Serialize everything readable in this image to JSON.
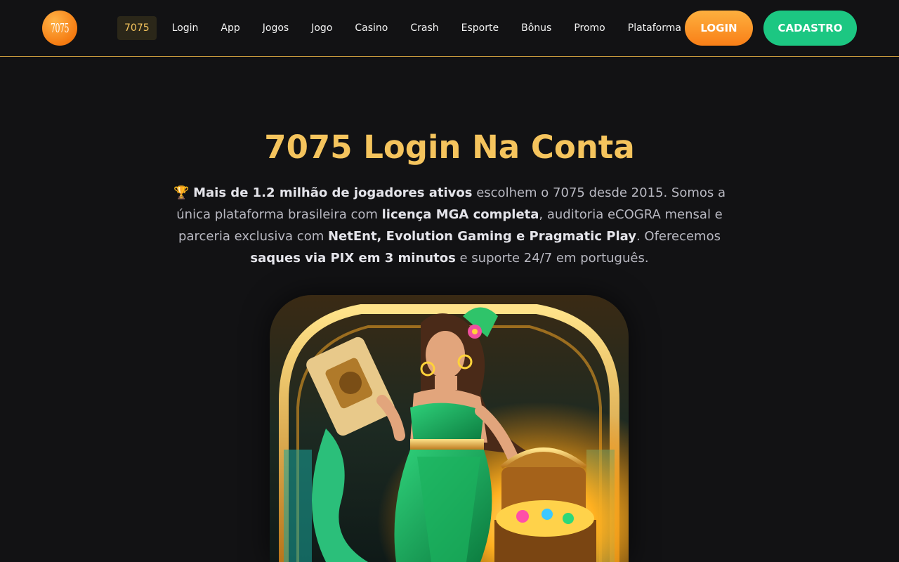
{
  "header": {
    "logo_text": "7075",
    "nav": [
      {
        "label": "7075",
        "active": true
      },
      {
        "label": "Login"
      },
      {
        "label": "App"
      },
      {
        "label": "Jogos"
      },
      {
        "label": "Jogo"
      },
      {
        "label": "Casino"
      },
      {
        "label": "Crash"
      },
      {
        "label": "Esporte"
      },
      {
        "label": "Bônus"
      },
      {
        "label": "Promo"
      },
      {
        "label": "Plataforma"
      }
    ],
    "login_button": "LOGIN",
    "signup_button": "CADASTRO"
  },
  "main": {
    "title": "7075 Login Na Conta",
    "intro": {
      "trophy_icon": "🏆",
      "p1_bold": "Mais de 1.2 milhão de jogadores ativos",
      "p2": " escolhem o 7075 desde 2015. Somos a única plataforma brasileira com ",
      "p3_bold": "licença MGA completa",
      "p4": ", auditoria eCOGRA mensal e parceria exclusiva com ",
      "p5_bold": "NetEnt, Evolution Gaming e Pragmatic Play",
      "p6": ". Oferecemos ",
      "p7_bold": "saques via PIX em 3 minutos",
      "p8": " e suporte 24/7 em português."
    },
    "hero_image": "hero-illustration"
  },
  "colors": {
    "accent": "#f5c45d",
    "login_button": "#f97f17",
    "signup_button": "#1cc782",
    "background": "#121214"
  }
}
